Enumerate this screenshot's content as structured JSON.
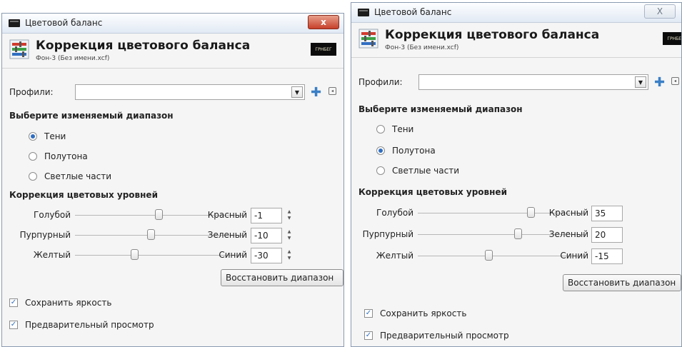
{
  "colors": {
    "accent": "#2f6ec1",
    "close_red": "#c7402a"
  },
  "icons": {
    "window": "window-icon",
    "close": "close-icon",
    "tool": "color-balance-icon",
    "add": "plus-icon",
    "menu": "menu-icon",
    "dropdown": "chevron-down-icon"
  },
  "dialogs": [
    {
      "window_title": "Цветовой баланс",
      "close_glyph": "x",
      "header_title": "Коррекция цветового баланса",
      "header_subtitle": "Фон-3 (Без имени.xcf)",
      "thumb_text": "ГРНБЕГ",
      "profiles_label": "Профили:",
      "profiles_value": "",
      "range_heading": "Выберите изменяемый диапазон",
      "ranges": [
        {
          "label": "Тени",
          "selected": true
        },
        {
          "label": "Полутона",
          "selected": false
        },
        {
          "label": "Светлые части",
          "selected": false
        }
      ],
      "levels_heading": "Коррекция цветовых уровней",
      "sliders": [
        {
          "left": "Голубой",
          "right": "Красный",
          "value": "-1",
          "level": -1
        },
        {
          "left": "Пурпурный",
          "right": "Зеленый",
          "value": "-10",
          "level": -10
        },
        {
          "left": "Желтый",
          "right": "Синий",
          "value": "-30",
          "level": -30
        }
      ],
      "reset_label": "Восстановить диапазон",
      "checks": [
        {
          "label": "Сохранить яркость",
          "checked": true
        },
        {
          "label": "Предварительный просмотр",
          "checked": true
        }
      ]
    },
    {
      "window_title": "Цветовой баланс",
      "close_glyph": "X",
      "header_title": "Коррекция цветового баланса",
      "header_subtitle": "Фон-3 (Без имени.xcf)",
      "thumb_text": "ГРНБЕГ",
      "profiles_label": "Профили:",
      "profiles_value": "",
      "range_heading": "Выберите изменяемый диапазон",
      "ranges": [
        {
          "label": "Тени",
          "selected": false
        },
        {
          "label": "Полутона",
          "selected": true
        },
        {
          "label": "Светлые части",
          "selected": false
        }
      ],
      "levels_heading": "Коррекция цветовых уровней",
      "sliders": [
        {
          "left": "Голубой",
          "right": "Красный",
          "value": "35",
          "level": 35
        },
        {
          "left": "Пурпурный",
          "right": "Зеленый",
          "value": "20",
          "level": 20
        },
        {
          "left": "Желтый",
          "right": "Синий",
          "value": "-15",
          "level": -15
        }
      ],
      "reset_label": "Восстановить диапазон",
      "checks": [
        {
          "label": "Сохранить яркость",
          "checked": true
        },
        {
          "label": "Предварительный просмотр",
          "checked": true
        }
      ]
    }
  ]
}
